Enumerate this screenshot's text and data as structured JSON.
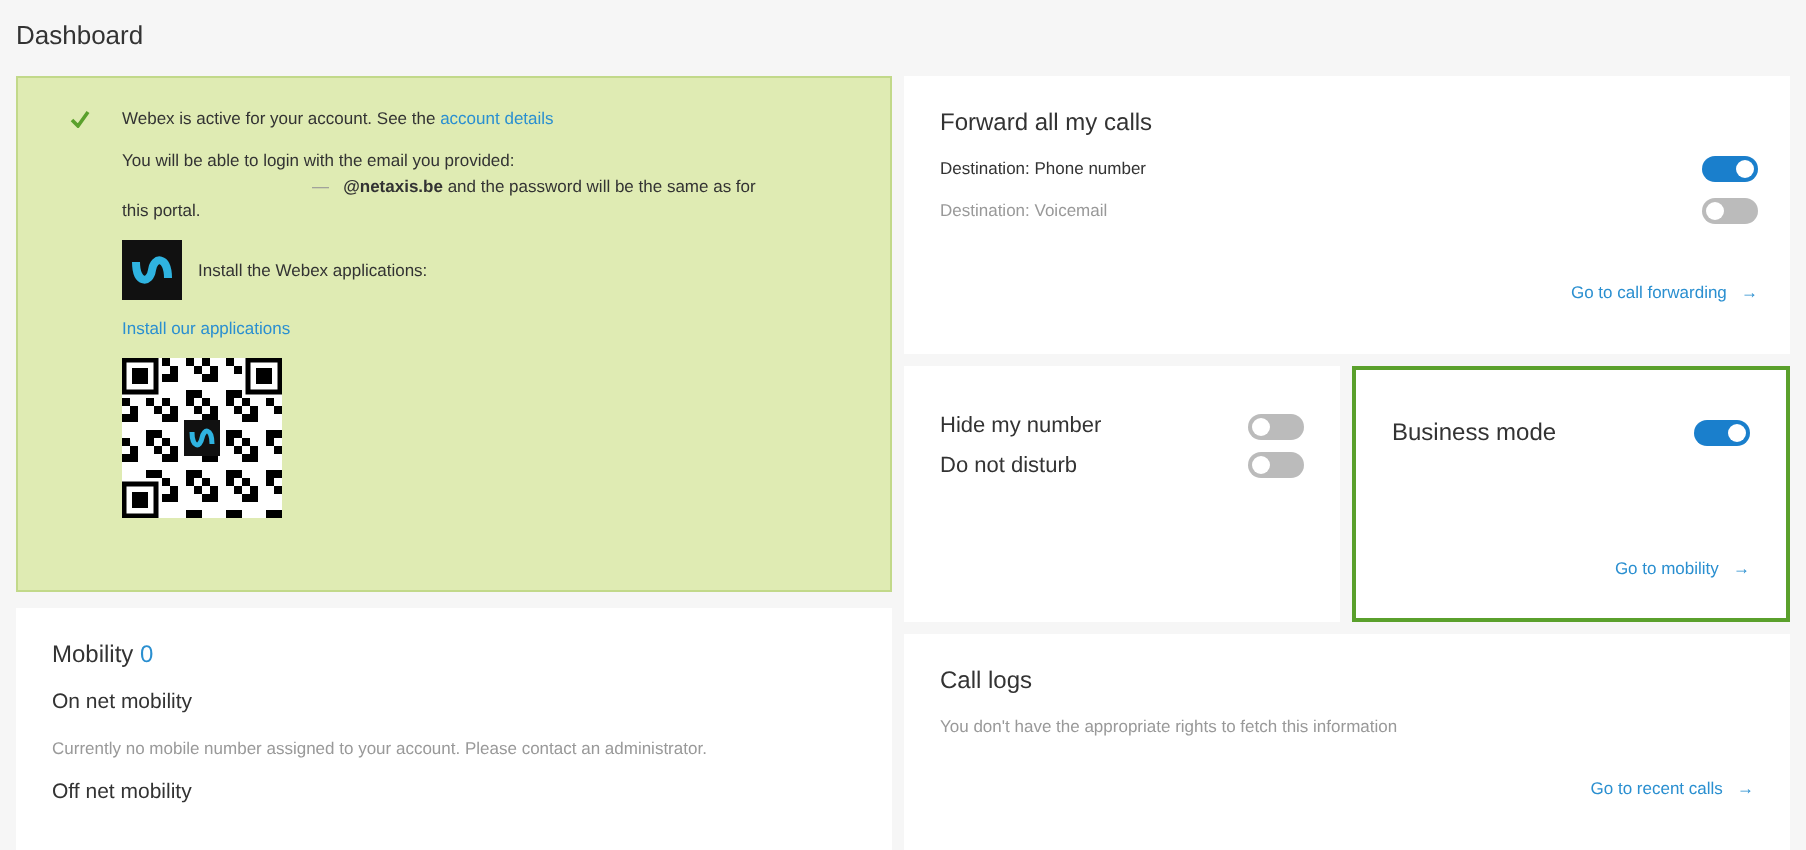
{
  "page_title": "Dashboard",
  "webex": {
    "status": "Webex is active for your account. See the",
    "status_link": "account details",
    "login_text": "You will be able to login with the email you provided:",
    "email_mark": "—",
    "login_text_2": "**@netaxis.be** and the password will be the same as for this portal.",
    "install_text": "Install the Webex applications:",
    "install_link": "Install our applications"
  },
  "forwarding": {
    "title": "Forward all my calls",
    "rows": [
      {
        "label": "Destination: Phone number",
        "on": true,
        "disabled": false
      },
      {
        "label": "Destination: Voicemail",
        "on": false,
        "disabled": true
      }
    ],
    "link": "Go to call forwarding",
    "link_arrow": "→"
  },
  "privacy": [
    {
      "label": "Hide my number",
      "on": false
    },
    {
      "label": "Do not disturb",
      "on": false
    }
  ],
  "business": {
    "label": "Business mode",
    "on": true,
    "selected": true,
    "link": "Go to mobility",
    "link_arrow": "→"
  },
  "mobility": {
    "title": "Mobility",
    "count": "0",
    "on_net": "On net mobility",
    "on_net_text": "Currently no mobile number assigned to your account. Please contact an administrator.",
    "off_net": "Off net mobility"
  },
  "call_logs": {
    "title": "Call logs",
    "text": "You don't have the appropriate rights to fetch this information",
    "link": "Go to recent calls",
    "link_arrow": "→"
  }
}
